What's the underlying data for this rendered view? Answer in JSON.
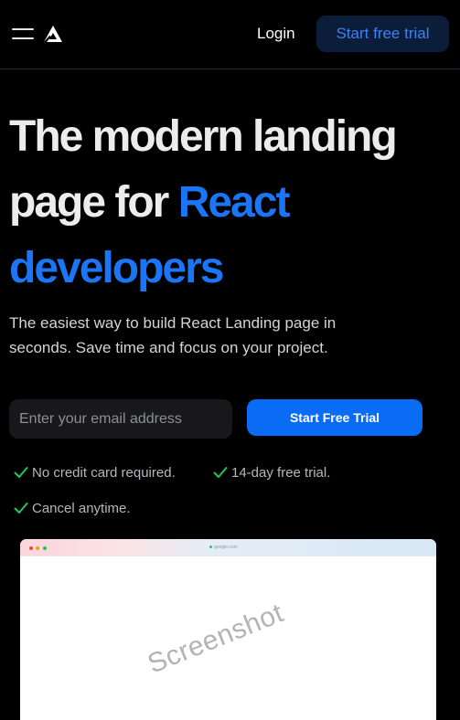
{
  "header": {
    "login_label": "Login",
    "trial_label": "Start free trial"
  },
  "hero": {
    "title_line1": "The modern landing",
    "title_line2_plain": "page for ",
    "title_line2_accent": "React",
    "title_line3_accent": "developers",
    "subtitle": "The easiest way to build React Landing page in seconds. Save time and focus on your project.",
    "email_placeholder": "Enter your email address",
    "cta_label": "Start Free Trial"
  },
  "features": [
    "No credit card required.",
    "14-day free trial.",
    "Cancel anytime."
  ],
  "preview": {
    "url": "google.com",
    "watermark": "Screenshot"
  },
  "colors": {
    "background": "#000000",
    "accent": "#1a76f6",
    "cta_button": "#0a6cf5",
    "top_button_bg": "#0b1d38",
    "check": "#22c55e"
  }
}
